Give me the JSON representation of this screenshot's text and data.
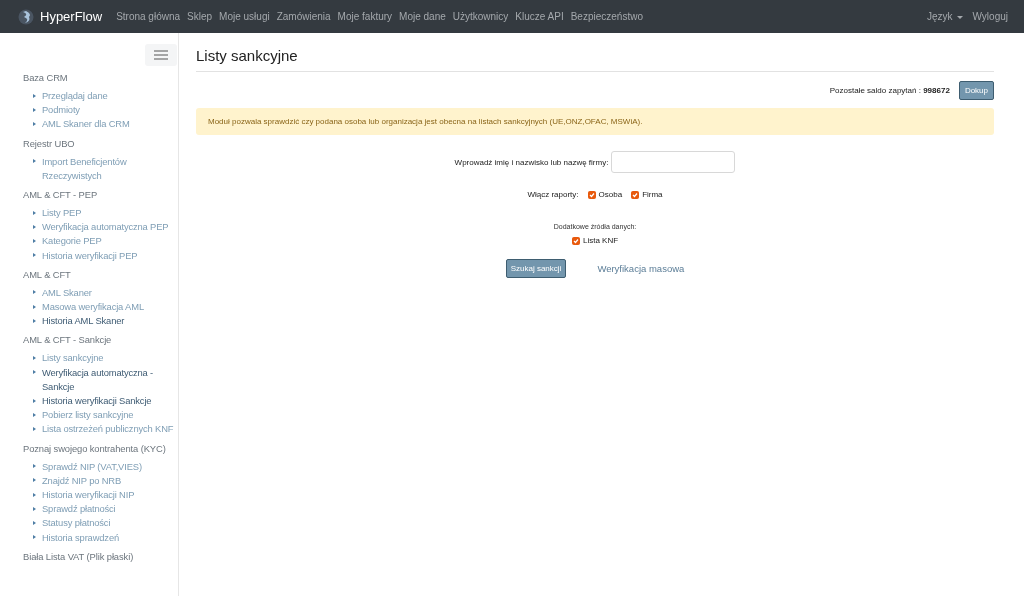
{
  "navbar": {
    "brand": "HyperFlow",
    "links": [
      "Strona główna",
      "Sklep",
      "Moje usługi",
      "Zamówienia",
      "Moje faktury",
      "Moje dane",
      "Użytkownicy",
      "Klucze API",
      "Bezpieczeństwo"
    ],
    "language": "Język",
    "logout": "Wyloguj"
  },
  "sidebar": {
    "groups": [
      {
        "title": "Baza CRM",
        "items": [
          {
            "label": "Przeglądaj dane",
            "visited": false
          },
          {
            "label": "Podmioty",
            "visited": false
          },
          {
            "label": "AML Skaner dla CRM",
            "visited": false
          }
        ]
      },
      {
        "title": "Rejestr UBO",
        "items": [
          {
            "label": "Import Beneficjentów Rzeczywistych",
            "visited": false
          }
        ]
      },
      {
        "title": "AML & CFT - PEP",
        "items": [
          {
            "label": "Listy PEP",
            "visited": false
          },
          {
            "label": "Weryfikacja automatyczna PEP",
            "visited": false
          },
          {
            "label": "Kategorie PEP",
            "visited": false
          },
          {
            "label": "Historia weryfikacji PEP",
            "visited": false
          }
        ]
      },
      {
        "title": "AML & CFT",
        "items": [
          {
            "label": "AML Skaner",
            "visited": false
          },
          {
            "label": "Masowa weryfikacja AML",
            "visited": false
          },
          {
            "label": "Historia AML Skaner",
            "visited": true
          }
        ]
      },
      {
        "title": "AML & CFT - Sankcje",
        "items": [
          {
            "label": "Listy sankcyjne",
            "visited": false
          },
          {
            "label": "Weryfikacja automatyczna - Sankcje",
            "visited": true
          },
          {
            "label": "Historia weryfikacji Sankcje",
            "visited": true
          },
          {
            "label": "Pobierz listy sankcyjne",
            "visited": false
          },
          {
            "label": "Lista ostrzeżeń publicznych KNF",
            "visited": false
          }
        ]
      },
      {
        "title": "Poznaj swojego kontrahenta (KYC)",
        "items": [
          {
            "label": "Sprawdź NIP (VAT,VIES)",
            "visited": false
          },
          {
            "label": "Znajdź NIP po NRB",
            "visited": false
          },
          {
            "label": "Historia weryfikacji NIP",
            "visited": false
          },
          {
            "label": "Sprawdź płatności",
            "visited": false
          },
          {
            "label": "Statusy płatności",
            "visited": false
          },
          {
            "label": "Historia sprawdzeń",
            "visited": false
          }
        ]
      },
      {
        "title": "Biała Lista VAT (Plik płaski)"
      }
    ]
  },
  "page": {
    "title": "Listy sankcyjne",
    "balance_label": "Pozostałe saldo zapytań :",
    "balance_value": "998672",
    "topup_button": "Dokup",
    "alert": "Moduł pozwala sprawdzić czy podana osoba lub organizacja jest obecna na listach sankcyjnych (UE,ONZ,OFAC, MSWiA).",
    "name_label": "Wprowadź imię i nazwisko lub nazwę firmy:",
    "reports_label": "Włącz raporty:",
    "reports": [
      {
        "label": "Osoba",
        "checked": true
      },
      {
        "label": "Firma",
        "checked": true
      }
    ],
    "sources_label": "Dodatkowe źródła danych:",
    "sources": [
      {
        "label": "Lista KNF",
        "checked": true
      }
    ],
    "search_button": "Szukaj sankcji",
    "mass_link": "Weryfikacja masowa"
  }
}
